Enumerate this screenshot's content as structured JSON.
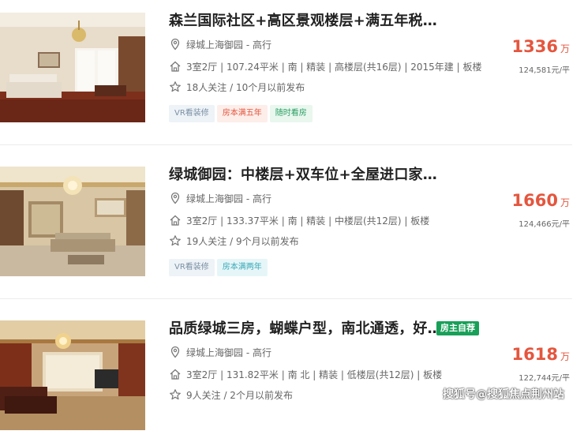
{
  "listings": [
    {
      "title": "森兰国际社区+高区景观楼层+满五年税…",
      "location": "绿城上海御园 - 高行",
      "info": "3室2厅 | 107.24平米 | 南 | 精装 | 高楼层(共16层) | 2015年建 | 板楼",
      "follow": "18人关注 / 10个月以前发布",
      "tags": [
        "VR看装修",
        "房本满五年",
        "随时看房"
      ],
      "price": "1336",
      "price_unit": "万",
      "unit_price": "124,581元/平"
    },
    {
      "title": "绿城御园：中楼层+双车位+全屋进口家…",
      "location": "绿城上海御园 - 高行",
      "info": "3室2厅 | 133.37平米 | 南 | 精装 | 中楼层(共12层) | 板楼",
      "follow": "19人关注 / 9个月以前发布",
      "tags": [
        "VR看装修",
        "房本满两年"
      ],
      "price": "1660",
      "price_unit": "万",
      "unit_price": "124,466元/平"
    },
    {
      "title": "品质绿城三房，蝴蝶户型，南北通透，好…",
      "owner_badge": "房主自荐",
      "location": "绿城上海御园 - 高行",
      "info": "3室2厅 | 131.82平米 | 南 北 | 精装 | 低楼层(共12层) | 板楼",
      "follow": "9人关注 / 2个月以前发布",
      "price": "1618",
      "price_unit": "万",
      "unit_price": "122,744元/平"
    }
  ],
  "watermark": "搜狐号@搜狐焦点荆州站",
  "colors": {
    "price": "#e4563e",
    "owner_badge": "#18a058",
    "title": "#222222"
  },
  "icons": [
    "location-pin-icon",
    "house-icon",
    "star-icon"
  ]
}
